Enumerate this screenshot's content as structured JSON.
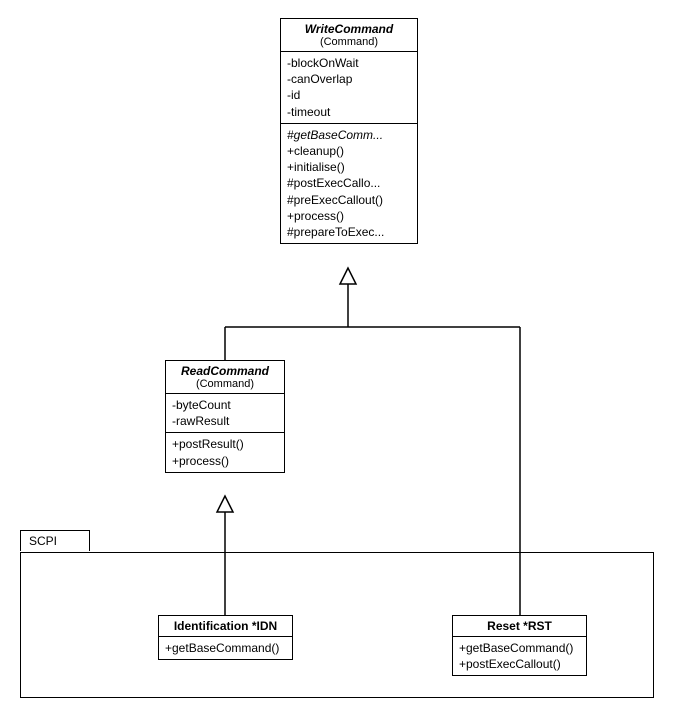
{
  "classes": {
    "writeCommand": {
      "name": "WriteCommand",
      "stereotype": "(Command)",
      "attributes": [
        "-blockOnWait",
        "-canOverlap",
        "-id",
        "-timeout"
      ],
      "operations": [
        "#getBaseComm...",
        "+cleanup()",
        "+initialise()",
        "#postExecCallo...",
        "#preExecCallout()",
        "+process()",
        "#prepareToExec..."
      ]
    },
    "readCommand": {
      "name": "ReadCommand",
      "stereotype": "(Command)",
      "attributes": [
        "-byteCount",
        "-rawResult"
      ],
      "operations": [
        "+postResult()",
        "+process()"
      ]
    },
    "identification": {
      "name": "Identification *IDN",
      "operations": [
        "+getBaseCommand()"
      ]
    },
    "reset": {
      "name": "Reset *RST",
      "operations": [
        "+getBaseCommand()",
        "+postExecCallout()"
      ]
    }
  },
  "package": {
    "name": "SCPI"
  },
  "chart_data": {
    "type": "uml_class_diagram",
    "classes": [
      {
        "id": "WriteCommand",
        "abstract": true,
        "stereotype": "Command",
        "attributes": [
          "-blockOnWait",
          "-canOverlap",
          "-id",
          "-timeout"
        ],
        "operations": [
          "#getBaseComm...",
          "+cleanup()",
          "+initialise()",
          "#postExecCallo...",
          "#preExecCallout()",
          "+process()",
          "#prepareToExec..."
        ]
      },
      {
        "id": "ReadCommand",
        "abstract": true,
        "stereotype": "Command",
        "attributes": [
          "-byteCount",
          "-rawResult"
        ],
        "operations": [
          "+postResult()",
          "+process()"
        ]
      },
      {
        "id": "Identification *IDN",
        "package": "SCPI",
        "operations": [
          "+getBaseCommand()"
        ]
      },
      {
        "id": "Reset *RST",
        "package": "SCPI",
        "operations": [
          "+getBaseCommand()",
          "+postExecCallout()"
        ]
      }
    ],
    "relationships": [
      {
        "type": "generalization",
        "child": "ReadCommand",
        "parent": "WriteCommand"
      },
      {
        "type": "generalization",
        "child": "Reset *RST",
        "parent": "WriteCommand"
      },
      {
        "type": "generalization",
        "child": "Identification *IDN",
        "parent": "ReadCommand"
      }
    ],
    "packages": [
      {
        "name": "SCPI",
        "members": [
          "Identification *IDN",
          "Reset *RST"
        ]
      }
    ]
  }
}
